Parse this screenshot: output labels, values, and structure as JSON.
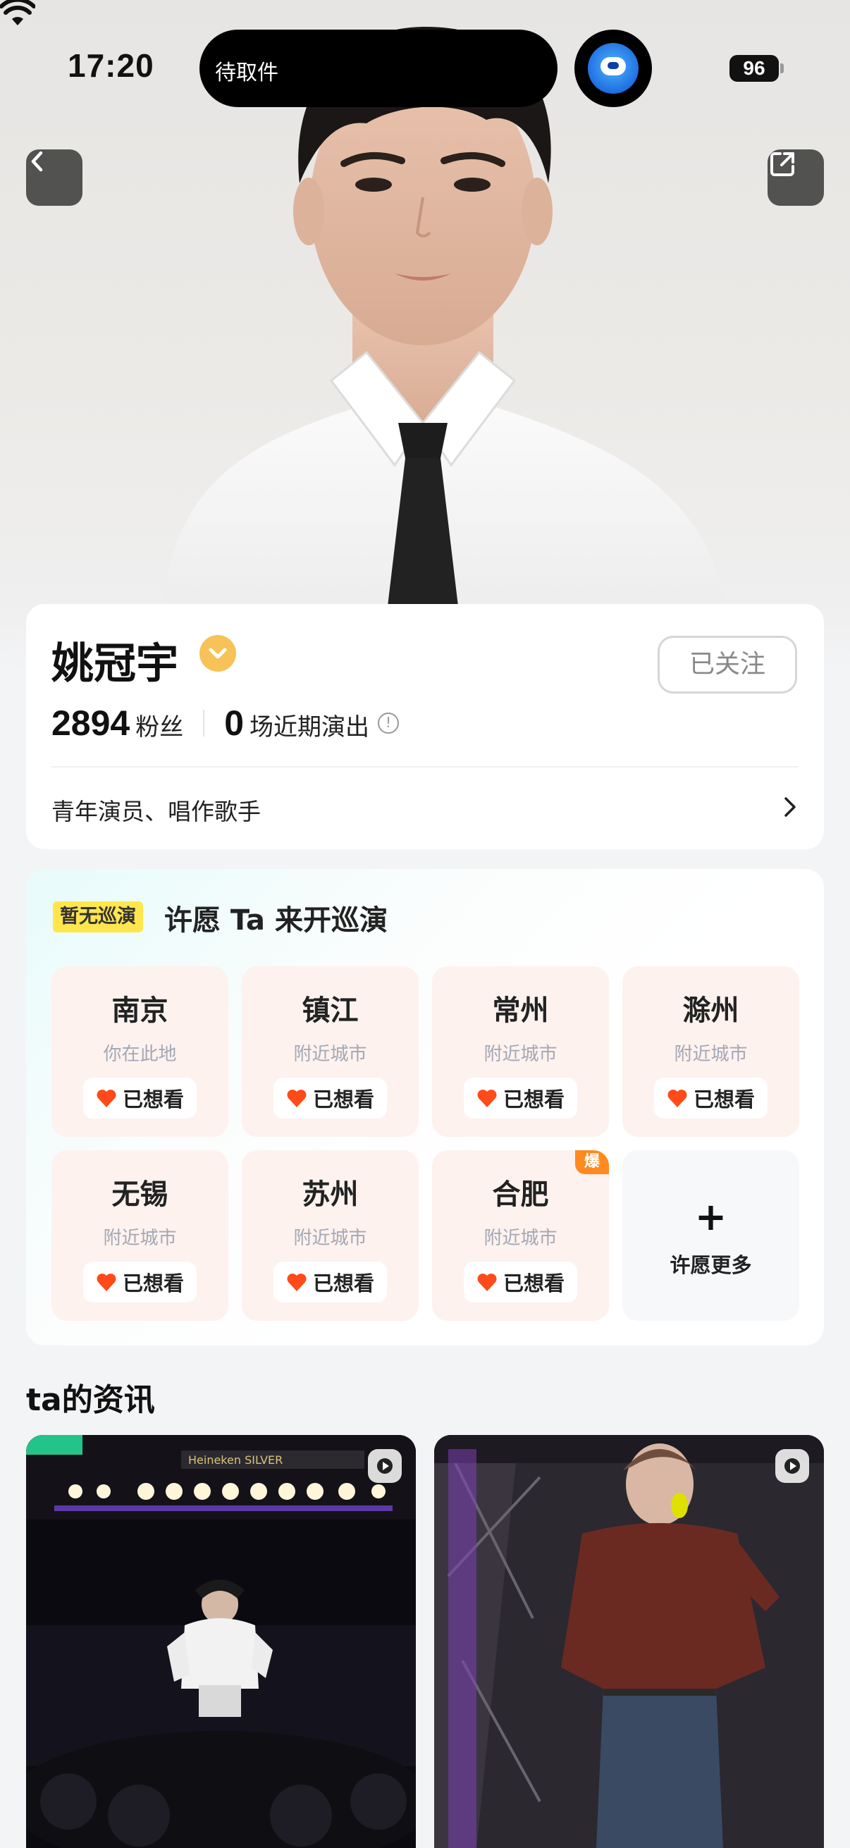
{
  "status_bar": {
    "time": "17:20",
    "island_text": "待取件",
    "battery": "96"
  },
  "nav": {
    "back_icon": "chevron-left-icon",
    "share_icon": "share-icon"
  },
  "profile": {
    "name": "姚冠宇",
    "follow_label": "已关注",
    "fans_count": "2894",
    "fans_label": "粉丝",
    "shows_count": "0",
    "shows_label": "场近期演出",
    "description": "青年演员、唱作歌手"
  },
  "wish": {
    "tag": "暂无巡演",
    "title": "许愿 Ta 来开巡演",
    "cities": [
      {
        "name": "南京",
        "sub": "你在此地",
        "button": "已想看"
      },
      {
        "name": "镇江",
        "sub": "附近城市",
        "button": "已想看"
      },
      {
        "name": "常州",
        "sub": "附近城市",
        "button": "已想看"
      },
      {
        "name": "滁州",
        "sub": "附近城市",
        "button": "已想看"
      },
      {
        "name": "无锡",
        "sub": "附近城市",
        "button": "已想看"
      },
      {
        "name": "苏州",
        "sub": "附近城市",
        "button": "已想看"
      },
      {
        "name": "合肥",
        "sub": "附近城市",
        "button": "已想看",
        "badge": "爆"
      }
    ],
    "more_label": "许愿更多"
  },
  "news": {
    "title": "ta的资讯"
  },
  "colors": {
    "heart": "#ff4a1a",
    "tag_yellow": "#ffe64d",
    "hot_orange": "#ff8a1f",
    "tile_bg": "#fdf2ee"
  }
}
